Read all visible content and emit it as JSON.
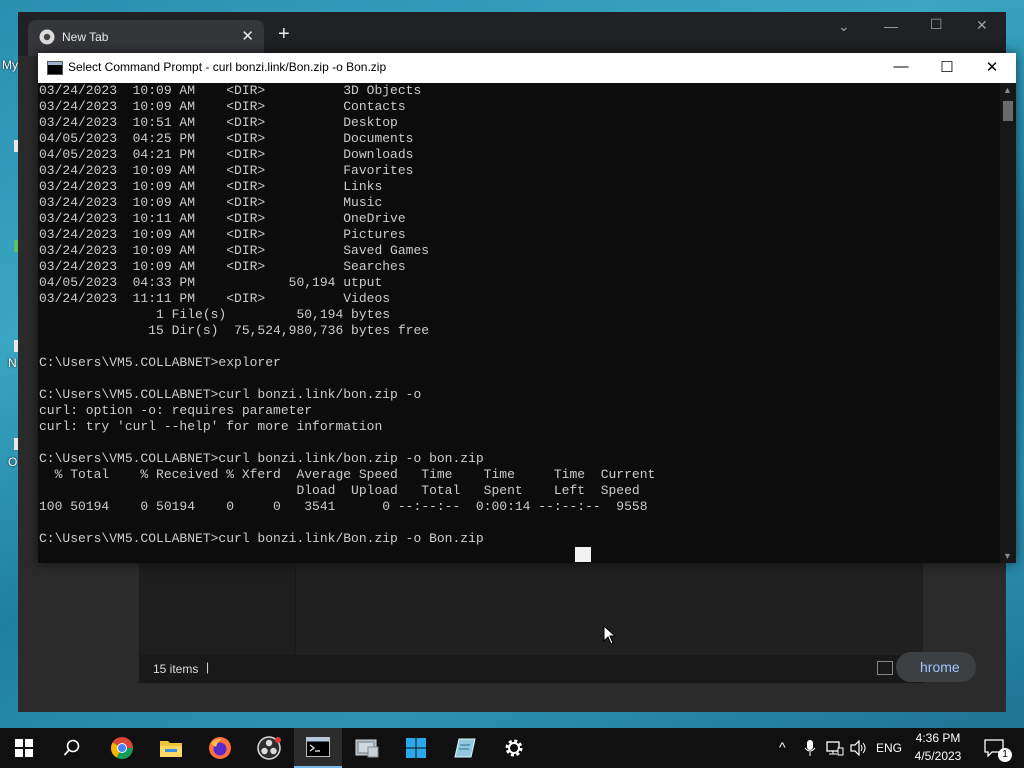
{
  "desktop": {
    "partial_labels": [
      "My",
      "N",
      "O"
    ]
  },
  "chrome": {
    "tab_title": "New Tab",
    "tab_close": "✕",
    "new_tab": "+",
    "ctrl_menu": "⌄",
    "ctrl_min": "—",
    "ctrl_max": "☐",
    "ctrl_close": "✕",
    "side_pill_text": "hrome"
  },
  "explorer": {
    "status_count": "15 items",
    "status_sep": "|"
  },
  "cmd": {
    "title": "Select Command Prompt - curl  bonzi.link/Bon.zip -o Bon.zip",
    "btn_min": "—",
    "btn_max": "☐",
    "btn_close": "✕",
    "lines": [
      "03/24/2023  10:09 AM    <DIR>          3D Objects",
      "03/24/2023  10:09 AM    <DIR>          Contacts",
      "03/24/2023  10:51 AM    <DIR>          Desktop",
      "04/05/2023  04:25 PM    <DIR>          Documents",
      "04/05/2023  04:21 PM    <DIR>          Downloads",
      "03/24/2023  10:09 AM    <DIR>          Favorites",
      "03/24/2023  10:09 AM    <DIR>          Links",
      "03/24/2023  10:09 AM    <DIR>          Music",
      "03/24/2023  10:11 AM    <DIR>          OneDrive",
      "03/24/2023  10:09 AM    <DIR>          Pictures",
      "03/24/2023  10:09 AM    <DIR>          Saved Games",
      "03/24/2023  10:09 AM    <DIR>          Searches",
      "04/05/2023  04:33 PM            50,194 utput",
      "03/24/2023  11:11 PM    <DIR>          Videos",
      "               1 File(s)         50,194 bytes",
      "              15 Dir(s)  75,524,980,736 bytes free",
      "",
      "C:\\Users\\VM5.COLLABNET>explorer",
      "",
      "C:\\Users\\VM5.COLLABNET>curl bonzi.link/bon.zip -o",
      "curl: option -o: requires parameter",
      "curl: try 'curl --help' for more information",
      "",
      "C:\\Users\\VM5.COLLABNET>curl bonzi.link/bon.zip -o bon.zip",
      "  % Total    % Received % Xferd  Average Speed   Time    Time     Time  Current",
      "                                 Dload  Upload   Total   Spent    Left  Speed",
      "100 50194    0 50194    0     0   3541      0 --:--:--  0:00:14 --:--:--  9558",
      "",
      "C:\\Users\\VM5.COLLABNET>curl bonzi.link/Bon.zip -o Bon.zip"
    ]
  },
  "taskbar": {
    "items": [
      "start-icon",
      "search-icon",
      "chrome-icon",
      "file-explorer-icon",
      "firefox-icon",
      "obs-icon",
      "cmd-icon",
      "app-icon",
      "windows-store-icon",
      "notepad-icon",
      "settings-icon"
    ],
    "lang": "ENG",
    "time": "4:36 PM",
    "date": "4/5/2023",
    "notification_count": "1",
    "tray_up": "^"
  }
}
